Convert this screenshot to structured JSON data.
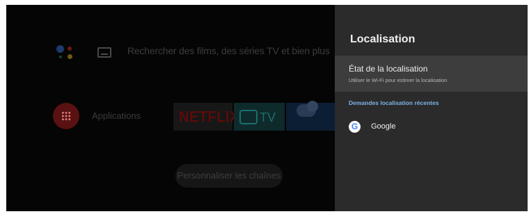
{
  "home": {
    "search_placeholder": "Rechercher des films, des séries TV et bien plus",
    "apps_label": "Applications",
    "netflix_label": "NETFLIX",
    "tv_label": "TV",
    "customize_label": "Personnaliser les chaînes"
  },
  "panel": {
    "title": "Localisation",
    "items": [
      {
        "title": "État de la localisation",
        "subtitle": "Utiliser le Wi-Fi pour estimer la localisation"
      }
    ],
    "section_header": "Demandes localisation récentes",
    "recent_requests": [
      {
        "name": "Google",
        "icon": "google-g-icon"
      }
    ]
  },
  "colors": {
    "panel_bg": "#2b2b2b",
    "focus_bg": "#3d3d3d",
    "section_accent": "#7fb3e8"
  }
}
